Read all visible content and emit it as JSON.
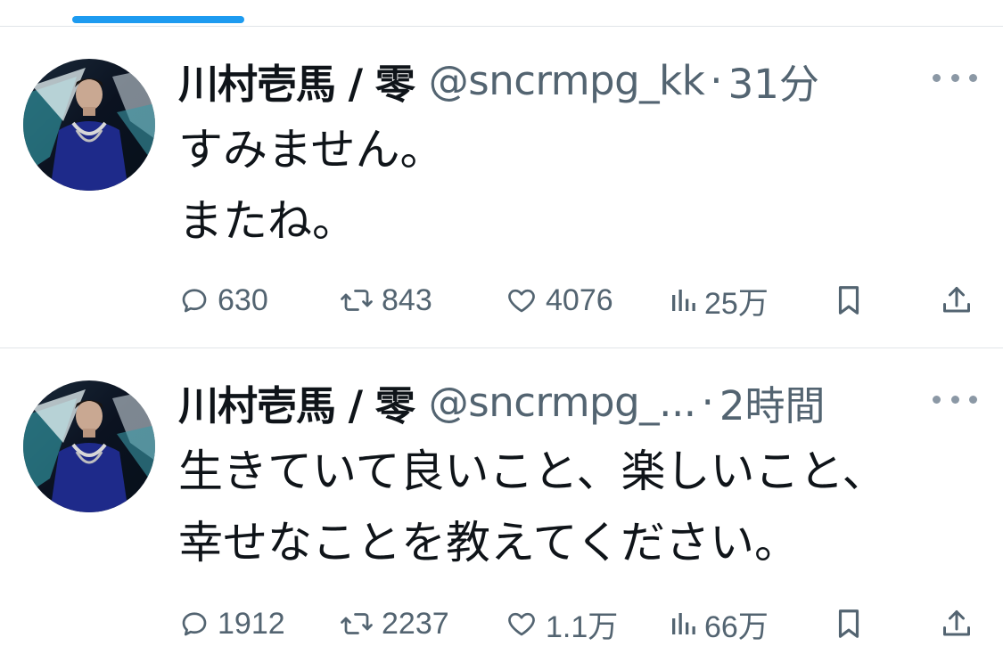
{
  "tweets": [
    {
      "name": "川村壱馬 / 零",
      "handle": "@sncrmpg_kk",
      "separator": "·",
      "time": "31分",
      "lines": [
        "すみません。",
        "またね。"
      ],
      "stats": {
        "replies": "630",
        "retweets": "843",
        "likes": "4076",
        "views": "25万"
      }
    },
    {
      "name": "川村壱馬 / 零",
      "handle": "@sncrmpg_...",
      "separator": "·",
      "time": "2時間",
      "lines": [
        "生きていて良いこと、楽しいこと、",
        "幸せなことを教えてください。"
      ],
      "stats": {
        "replies": "1912",
        "retweets": "2237",
        "likes": "1.1万",
        "views": "66万"
      }
    }
  ],
  "icons": {
    "reply": "reply-icon",
    "retweet": "retweet-icon",
    "like": "heart-icon",
    "views": "views-icon",
    "bookmark": "bookmark-icon",
    "share": "share-icon",
    "more": "more-icon"
  },
  "colors": {
    "accent": "#1d9bf0",
    "text_primary": "#0f1419",
    "text_secondary": "#536471",
    "divider": "#e1e5e8"
  }
}
